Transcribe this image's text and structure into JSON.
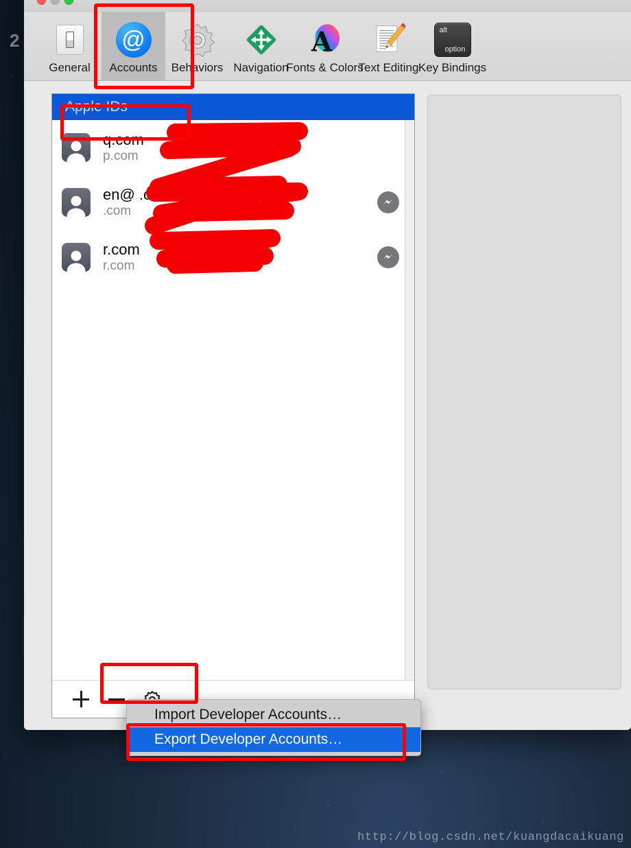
{
  "desktop": {
    "number_label": "2",
    "watermark": "http://blog.csdn.net/kuangdacaikuang"
  },
  "window": {
    "traffic_lights": {
      "close": "close-button",
      "minimize": "minimize-button",
      "zoom": "zoom-button"
    },
    "toolbar": {
      "items": [
        {
          "label": "General",
          "icon": "general-switch-icon",
          "selected": false
        },
        {
          "label": "Accounts",
          "icon": "at-sign-icon",
          "selected": true
        },
        {
          "label": "Behaviors",
          "icon": "gear-icon",
          "selected": false
        },
        {
          "label": "Navigation",
          "icon": "four-arrows-icon",
          "selected": false
        },
        {
          "label": "Fonts & Colors",
          "icon": "letter-a-color-icon",
          "selected": false
        },
        {
          "label": "Text Editing",
          "icon": "document-pencil-icon",
          "selected": false
        },
        {
          "label": "Key Bindings",
          "icon": "alt-option-key-icon",
          "selected": false
        }
      ]
    }
  },
  "accounts_panel": {
    "header": "Apple IDs",
    "rows": [
      {
        "primary": "q.com",
        "secondary": "p.com",
        "badge": false,
        "badge_icon": ""
      },
      {
        "primary": "en@ .com",
        "secondary": ".com",
        "badge": true,
        "badge_icon": "messenger-badge-icon"
      },
      {
        "primary": "r.com",
        "secondary": "r.com",
        "badge": true,
        "badge_icon": "messenger-badge-icon"
      }
    ],
    "footer": {
      "add_label": "+",
      "remove_label": "−",
      "gear_label": "gear-icon"
    }
  },
  "gear_menu": {
    "items": [
      {
        "label": "Import Developer Accounts…",
        "selected": false
      },
      {
        "label": "Export Developer Accounts…",
        "selected": true
      }
    ]
  },
  "colors": {
    "selection_blue": "#0a58d6",
    "menu_highlight_blue": "#1168e0",
    "annotation_red": "#fe0000",
    "redaction_red": "#f40000",
    "window_chrome": "#e9e9e9"
  }
}
